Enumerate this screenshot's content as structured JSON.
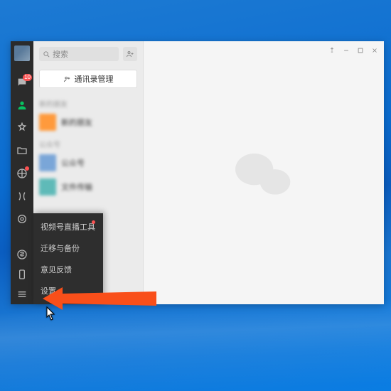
{
  "search": {
    "placeholder": "搜索"
  },
  "contacts": {
    "manage_label": "通讯录管理",
    "section_a": "新的朋友",
    "section_b": "公众号",
    "items": [
      {
        "name": "新的朋友"
      },
      {
        "name": "公众号"
      },
      {
        "name": "文件传输"
      }
    ]
  },
  "nav": {
    "chat_badge": "10"
  },
  "menu": {
    "items": [
      {
        "label": "视频号直播工具",
        "has_dot": true
      },
      {
        "label": "迁移与备份",
        "has_dot": false
      },
      {
        "label": "意见反馈",
        "has_dot": false
      },
      {
        "label": "设置",
        "has_dot": false
      }
    ]
  },
  "colors": {
    "accent_green": "#08c160",
    "badge_red": "#fa5151",
    "arrow": "#f94f1a"
  }
}
